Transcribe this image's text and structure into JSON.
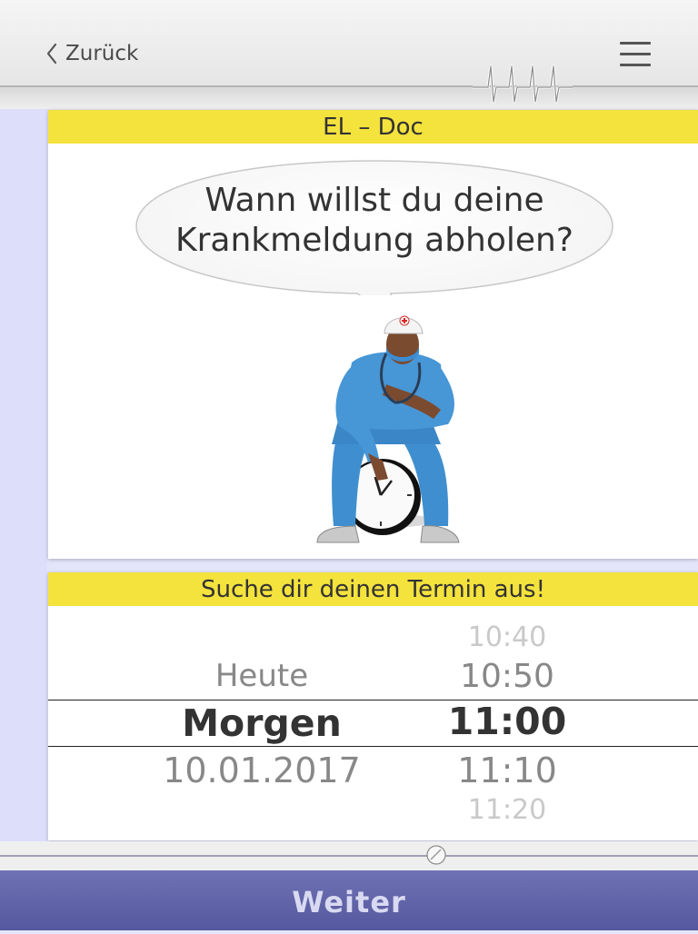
{
  "nav": {
    "back_label": "Zurück"
  },
  "card1": {
    "title": "EL – Doc",
    "speech_line1": "Wann willst du deine",
    "speech_line2": "Krankmeldung abholen?"
  },
  "card2": {
    "title": "Suche dir deinen Termin aus!"
  },
  "picker": {
    "dates": {
      "above": "Heute",
      "selected": "Morgen",
      "below": "10.01.2017"
    },
    "times": {
      "above2": "10:40",
      "above1": "10:50",
      "selected": "11:00",
      "below1": "11:10",
      "below2": "11:20"
    }
  },
  "footer": {
    "next_label": "Weiter"
  },
  "colors": {
    "accent_yellow": "#f4e23d",
    "button_purple": "#5f62a8",
    "background_lavender": "#e3e5fb"
  }
}
